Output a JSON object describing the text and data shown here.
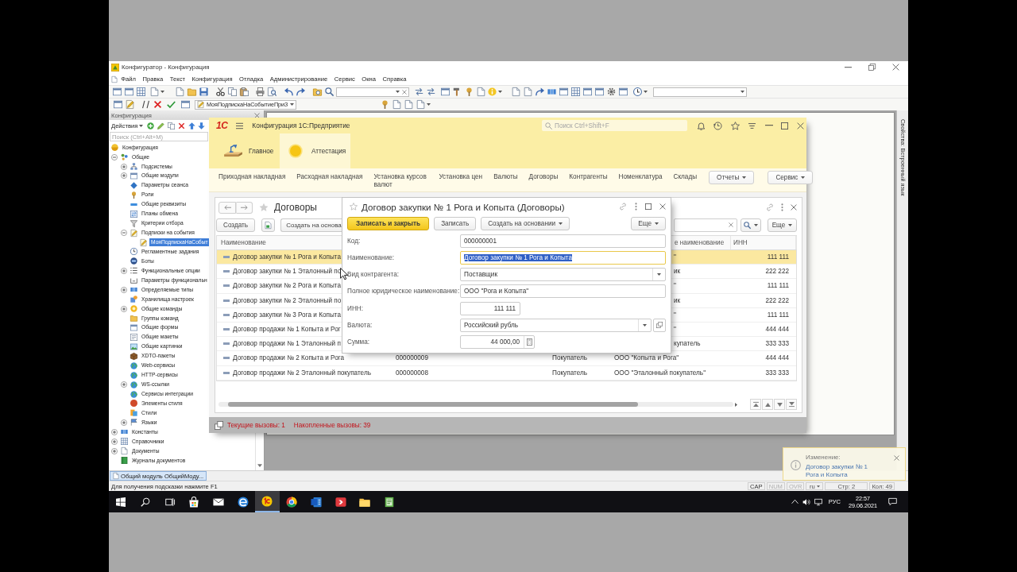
{
  "configurator": {
    "title": "Конфигуратор - Конфигурация",
    "menu": [
      "Файл",
      "Правка",
      "Текст",
      "Конфигурация",
      "Отладка",
      "Администрирование",
      "Сервис",
      "Окна",
      "Справка"
    ],
    "toolbar_dropdown": "МояПодпискаНаСобытиеПриЗ",
    "config_panel": {
      "title": "Конфигурация",
      "actions": "Действия",
      "search": {
        "placeholder": "Поиск (Ctrl+Alt+M)"
      },
      "tree": [
        {
          "label": "Конфигурация",
          "selected": false,
          "children": [
            {
              "label": "Общие",
              "selected": false,
              "expanded": true,
              "children": [
                {
                  "label": "Подсистемы",
                  "selected": false,
                  "expanded": false
                },
                {
                  "label": "Общие модули",
                  "selected": false,
                  "expanded": false
                },
                {
                  "label": "Параметры сеанса",
                  "selected": false
                },
                {
                  "label": "Роли",
                  "selected": false
                },
                {
                  "label": "Общие реквизиты",
                  "selected": false
                },
                {
                  "label": "Планы обмена",
                  "selected": false
                },
                {
                  "label": "Критерии отбора",
                  "selected": false
                },
                {
                  "label": "Подписки на события",
                  "selected": false,
                  "expanded": true,
                  "children": [
                    {
                      "label": "МояПодпискаНаСобыт",
                      "selected": true
                    }
                  ]
                },
                {
                  "label": "Регламентные задания",
                  "selected": false
                },
                {
                  "label": "Боты",
                  "selected": false
                },
                {
                  "label": "Функциональные опции",
                  "selected": false,
                  "expanded": false
                },
                {
                  "label": "Параметры функциональн",
                  "selected": false
                },
                {
                  "label": "Определяемые типы",
                  "selected": false,
                  "expanded": false
                },
                {
                  "label": "Хранилища настроек",
                  "selected": false
                },
                {
                  "label": "Общие команды",
                  "selected": false,
                  "expanded": false
                },
                {
                  "label": "Группы команд",
                  "selected": false
                },
                {
                  "label": "Общие формы",
                  "selected": false
                },
                {
                  "label": "Общие макеты",
                  "selected": false
                },
                {
                  "label": "Общие картинки",
                  "selected": false
                },
                {
                  "label": "XDTO-пакеты",
                  "selected": false
                },
                {
                  "label": "Web-сервисы",
                  "selected": false
                },
                {
                  "label": "HTTP-сервисы",
                  "selected": false
                },
                {
                  "label": "WS-ссылки",
                  "selected": false,
                  "expanded": false
                },
                {
                  "label": "Сервисы интеграции",
                  "selected": false
                },
                {
                  "label": "Элементы стиля",
                  "selected": false
                },
                {
                  "label": "Стили",
                  "selected": false
                },
                {
                  "label": "Языки",
                  "selected": false,
                  "expanded": false
                }
              ]
            },
            {
              "label": "Константы",
              "selected": false,
              "expanded": false
            },
            {
              "label": "Справочники",
              "selected": false,
              "expanded": false
            },
            {
              "label": "Документы",
              "selected": false,
              "expanded": false
            },
            {
              "label": "Журналы документов",
              "selected": false
            }
          ]
        }
      ]
    },
    "properties_title": "Свойства: Встроенный язык",
    "window_tabs": [
      {
        "label": "Общий модуль ОбщийМоду...",
        "selected": true
      }
    ],
    "status_text": "Для получения подсказки нажмите F1",
    "indicators": [
      {
        "label": "CAP",
        "on": true
      },
      {
        "label": "NUM",
        "on": false
      },
      {
        "label": "OVR",
        "on": false
      }
    ],
    "input_language": "ru",
    "line": "Стр: 2",
    "column": "Кол: 49"
  },
  "enterprise": {
    "logo": "1С",
    "title": "Конфигурация 1С:Предприятие",
    "search": {
      "placeholder": "Поиск Ctrl+Shift+F"
    },
    "sections": [
      {
        "label": "Главное",
        "selected": false
      },
      {
        "label": "Аттестация",
        "selected": true
      }
    ],
    "nav_links": [
      "Приходная накладная",
      "Расходная накладная",
      "Установка курсов валют",
      "Установка цен",
      "Валюты",
      "Договоры",
      "Контрагенты",
      "Номенклатура",
      "Склады"
    ],
    "nav_menus": [
      "Отчеты",
      "Сервис"
    ],
    "list": {
      "title": "Договоры",
      "create_button": "Создать",
      "create_based_button": "Создать на основа",
      "more_button": "Еще",
      "columns": {
        "name": "Наименование",
        "column_4": "е наименование",
        "inn": "ИНН"
      },
      "rows": [
        {
          "name": "Договор закупки № 1 Рога и Копыта",
          "column_4": "\"",
          "inn": "111 111",
          "selected": true
        },
        {
          "name": "Договор закупки № 1 Эталонный по",
          "column_4": "ик",
          "inn": "222 222",
          "selected": false
        },
        {
          "name": "Договор закупки № 2 Рога и Копыта",
          "column_4": "\"",
          "inn": "111 111",
          "selected": false
        },
        {
          "name": "Договор закупки № 2 Эталонный по",
          "column_4": "ик",
          "inn": "222 222",
          "selected": false
        },
        {
          "name": "Договор закупки № 3 Рога и Копыта",
          "column_4": "\"",
          "inn": "111 111",
          "selected": false
        },
        {
          "name": "Договор продажи № 1 Копыта и Рог",
          "column_4": "\"",
          "inn": "444 444",
          "selected": false
        },
        {
          "name": "Договор продажи № 1 Эталонный п",
          "column_4": "купатель",
          "inn": "333 333",
          "selected": false
        },
        {
          "name": "Договор продажи № 2 Копыта и Рога",
          "column_2": "000000009",
          "column_3": "Покупатель",
          "column_4": "ООО \"Копыта и Рога\"",
          "inn": "444 444",
          "selected": false
        },
        {
          "name": "Договор продажи № 2 Эталонный покупатель",
          "column_2": "000000008",
          "column_3": "Покупатель",
          "column_4": "ООО \"Эталонный покупатель\"",
          "inn": "333 333",
          "selected": false
        }
      ]
    },
    "form": {
      "title": "Договор закупки № 1 Рога и Копыта (Договоры)",
      "buttons": [
        {
          "label": "Записать и закрыть",
          "kind": "default"
        },
        {
          "label": "Записать",
          "kind": "plain"
        },
        {
          "label": "Создать на основании",
          "kind": "menu"
        }
      ],
      "more_button": "Еще",
      "fields": [
        {
          "label": "Код:",
          "value": "000000001",
          "kind": "text",
          "focused": false
        },
        {
          "label": "Наименование:",
          "value": "Договор закупки № 1 Рога и Копыта",
          "kind": "text",
          "focused": true
        },
        {
          "label": "Вид контрагента:",
          "value": "Поставщик",
          "kind": "dropdown",
          "focused": false
        },
        {
          "label": "Полное юридическое наименование:",
          "value": "ООО \"Рога и Копыта\"",
          "kind": "text",
          "focused": false
        },
        {
          "label": "ИНН:",
          "value": "111 111",
          "kind": "number",
          "focused": false
        },
        {
          "label": "Валюта:",
          "value": "Российский рубль",
          "kind": "reference",
          "focused": false
        },
        {
          "label": "Сумма:",
          "value": "44 000,00",
          "kind": "amount",
          "focused": false
        }
      ]
    },
    "status": [
      "Текущие вызовы: 1",
      "Накопленные вызовы: 39"
    ]
  },
  "notification": {
    "title": "Изменение:",
    "text": "Договор закупки № 1 Рога и Копыта"
  },
  "taskbar": {
    "apps": [
      {
        "selected": false
      },
      {
        "selected": false
      },
      {
        "selected": false
      },
      {
        "selected": true
      },
      {
        "selected": false
      },
      {
        "selected": false
      },
      {
        "selected": false
      },
      {
        "selected": false
      },
      {
        "selected": false
      }
    ],
    "language": "РУС",
    "time": "22:57",
    "date": "29.06.2021"
  }
}
